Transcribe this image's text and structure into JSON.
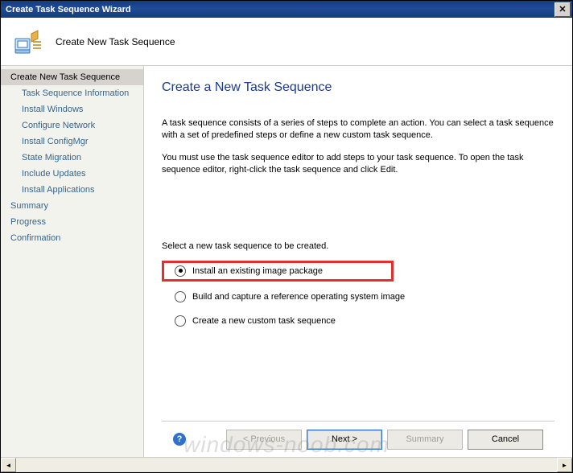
{
  "window": {
    "title": "Create Task Sequence Wizard"
  },
  "header": {
    "title": "Create New Task Sequence"
  },
  "sidebar": {
    "items": [
      {
        "label": "Create New Task Sequence",
        "selected": true,
        "sub": false
      },
      {
        "label": "Task Sequence Information",
        "selected": false,
        "sub": true
      },
      {
        "label": "Install Windows",
        "selected": false,
        "sub": true
      },
      {
        "label": "Configure Network",
        "selected": false,
        "sub": true
      },
      {
        "label": "Install ConfigMgr",
        "selected": false,
        "sub": true
      },
      {
        "label": "State Migration",
        "selected": false,
        "sub": true
      },
      {
        "label": "Include Updates",
        "selected": false,
        "sub": true
      },
      {
        "label": "Install Applications",
        "selected": false,
        "sub": true
      },
      {
        "label": "Summary",
        "selected": false,
        "sub": false
      },
      {
        "label": "Progress",
        "selected": false,
        "sub": false
      },
      {
        "label": "Confirmation",
        "selected": false,
        "sub": false
      }
    ]
  },
  "content": {
    "title": "Create a New Task Sequence",
    "desc1": "A task sequence consists of a series of steps to complete an action. You can select a task sequence with a set of predefined steps or define a new custom task sequence.",
    "desc2": "You must use the task sequence editor to add steps to your task sequence. To open the task sequence editor, right-click the task sequence and click Edit.",
    "instruction": "Select a new task sequence to be created.",
    "options": [
      {
        "label": "Install an existing image package",
        "selected": true,
        "highlighted": true
      },
      {
        "label": "Build and capture a reference operating system image",
        "selected": false,
        "highlighted": false
      },
      {
        "label": "Create a new custom task sequence",
        "selected": false,
        "highlighted": false
      }
    ]
  },
  "footer": {
    "buttons": {
      "previous": "< Previous",
      "next": "Next >",
      "summary": "Summary",
      "cancel": "Cancel"
    }
  },
  "watermark": "windows-noob.com",
  "colors": {
    "titlebar": "#153b7c",
    "heading": "#1a3c8a",
    "sidebar_link": "#36648b",
    "highlight_border": "#e03030"
  }
}
